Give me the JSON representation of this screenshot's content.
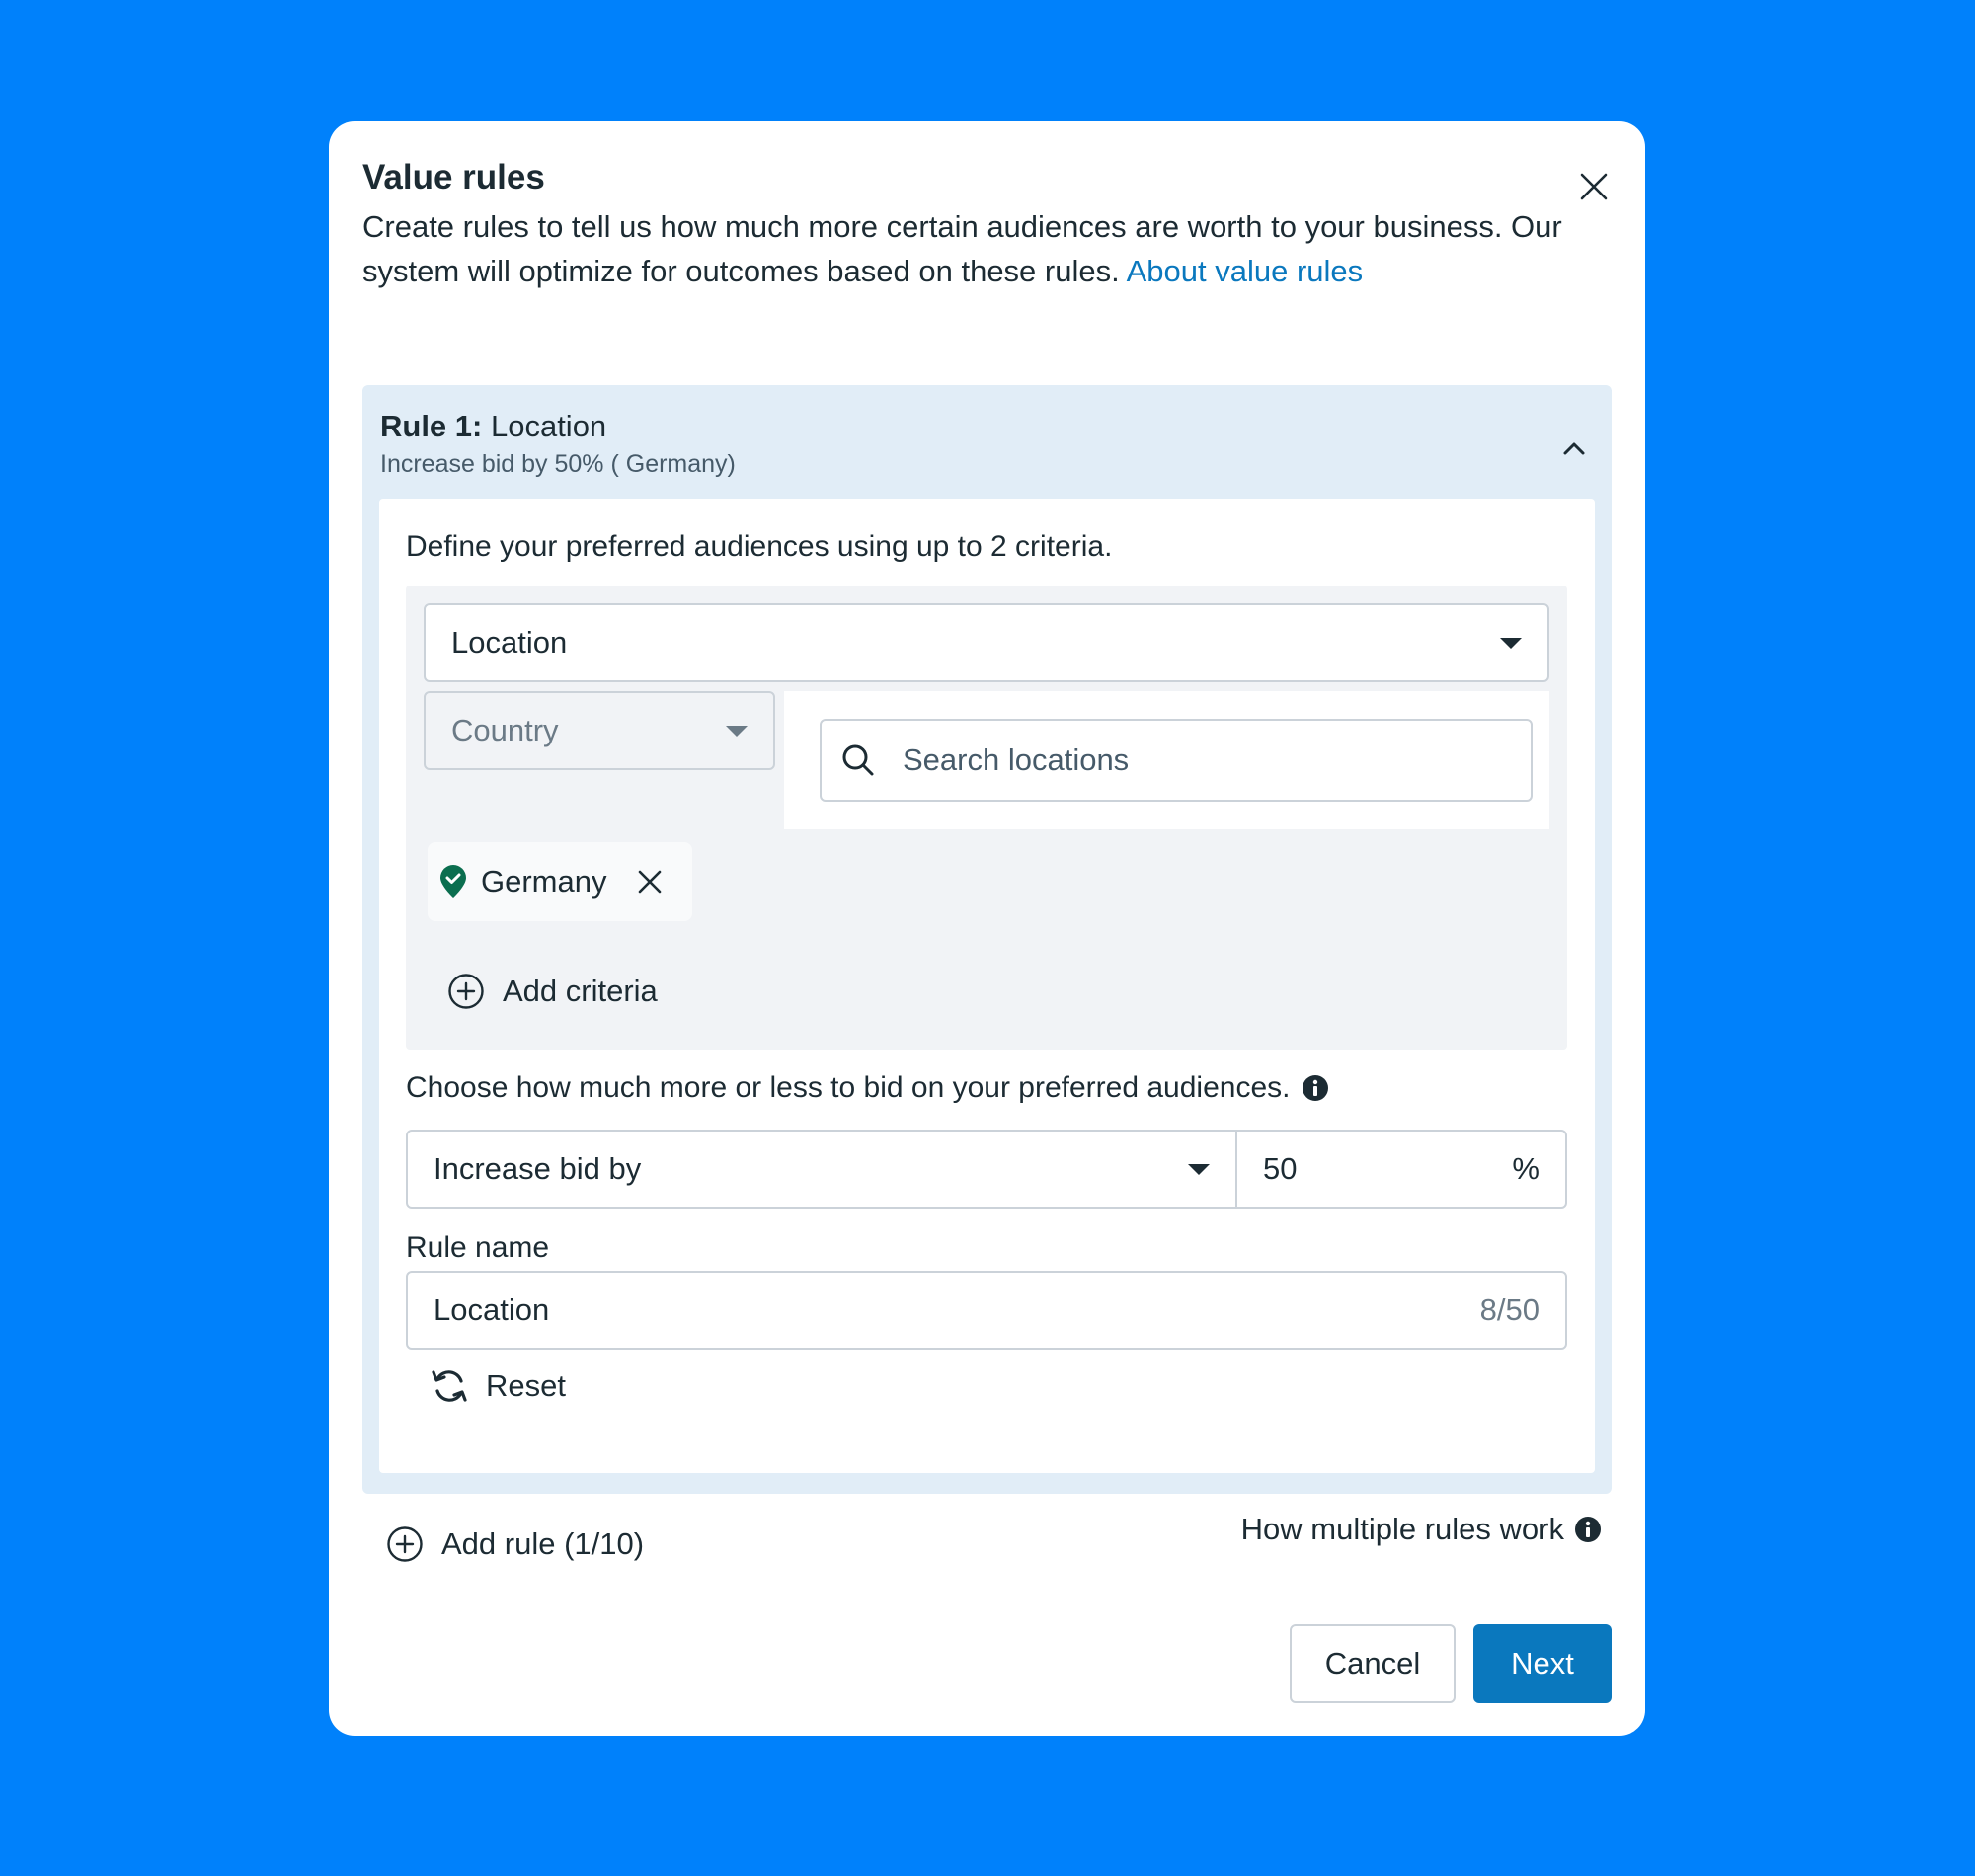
{
  "modal": {
    "title": "Value rules",
    "description": "Create rules to tell us how much more certain audiences are worth to your business. Our system will optimize for outcomes based on these rules. ",
    "about_link": "About value rules",
    "close_icon": "close-icon"
  },
  "rule": {
    "label_prefix": "Rule 1:",
    "label_name": " Location",
    "summary": "Increase bid by 50% ( Germany)",
    "define_text": "Define your preferred audiences using up to 2 criteria.",
    "criteria_select": "Location",
    "sub_select": "Country",
    "search_placeholder": "Search locations",
    "selected_chip": "Germany",
    "add_criteria": "Add criteria",
    "choose_text": "Choose how much more or less to bid on your preferred audiences.",
    "bid_option": "Increase bid by",
    "bid_value": "50",
    "bid_unit": "%",
    "rule_name_label": "Rule name",
    "rule_name_value": "Location",
    "rule_name_count": "8/50",
    "reset": "Reset"
  },
  "footer": {
    "add_rule": "Add rule (1/10)",
    "how_multiple": "How multiple rules work",
    "cancel": "Cancel",
    "next": "Next"
  },
  "colors": {
    "background": "#0081FB",
    "accent": "#0A78BE",
    "rule_panel": "#E1EDF7",
    "chip_pin": "#0B6E4F"
  }
}
